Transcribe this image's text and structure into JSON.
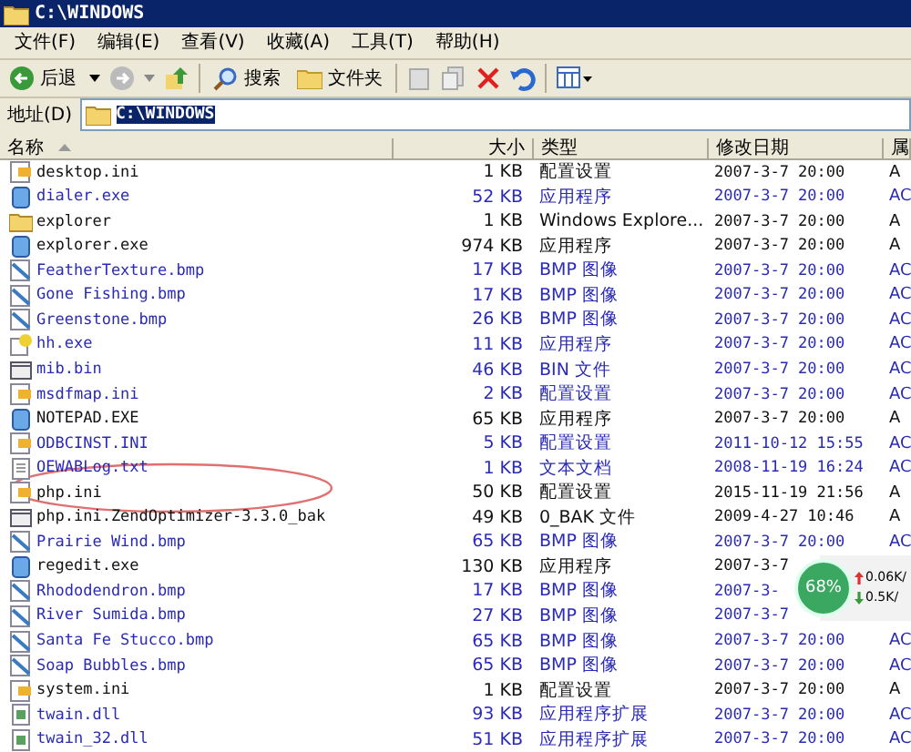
{
  "window": {
    "title": "C:\\WINDOWS"
  },
  "menu": [
    "文件(F)",
    "编辑(E)",
    "查看(V)",
    "收藏(A)",
    "工具(T)",
    "帮助(H)"
  ],
  "toolbar": {
    "back": "后退",
    "search": "搜索",
    "folders": "文件夹"
  },
  "address": {
    "label": "地址(D)",
    "value": "C:\\WINDOWS"
  },
  "columns": [
    "名称",
    "大小",
    "类型",
    "修改日期",
    "属"
  ],
  "rows": [
    {
      "kind": "ini",
      "name": "desktop.ini",
      "size": "1 KB",
      "type": "配置设置",
      "date": "2007-3-7 20:00",
      "attr": "A",
      "compressed": false
    },
    {
      "kind": "app",
      "name": "dialer.exe",
      "size": "52 KB",
      "type": "应用程序",
      "date": "2007-3-7 20:00",
      "attr": "AC",
      "compressed": true
    },
    {
      "kind": "folder",
      "name": "explorer",
      "size": "1 KB",
      "type": "Windows Explore...",
      "date": "2007-3-7 20:00",
      "attr": "A",
      "compressed": false
    },
    {
      "kind": "app",
      "name": "explorer.exe",
      "size": "974 KB",
      "type": "应用程序",
      "date": "2007-3-7 20:00",
      "attr": "A",
      "compressed": false
    },
    {
      "kind": "bmp",
      "name": "FeatherTexture.bmp",
      "size": "17 KB",
      "type": "BMP 图像",
      "date": "2007-3-7 20:00",
      "attr": "AC",
      "compressed": true
    },
    {
      "kind": "bmp",
      "name": "Gone Fishing.bmp",
      "size": "17 KB",
      "type": "BMP 图像",
      "date": "2007-3-7 20:00",
      "attr": "AC",
      "compressed": true
    },
    {
      "kind": "bmp",
      "name": "Greenstone.bmp",
      "size": "26 KB",
      "type": "BMP 图像",
      "date": "2007-3-7 20:00",
      "attr": "AC",
      "compressed": true
    },
    {
      "kind": "help",
      "name": "hh.exe",
      "size": "11 KB",
      "type": "应用程序",
      "date": "2007-3-7 20:00",
      "attr": "AC",
      "compressed": true
    },
    {
      "kind": "bin",
      "name": "mib.bin",
      "size": "46 KB",
      "type": "BIN 文件",
      "date": "2007-3-7 20:00",
      "attr": "AC",
      "compressed": true
    },
    {
      "kind": "ini",
      "name": "msdfmap.ini",
      "size": "2 KB",
      "type": "配置设置",
      "date": "2007-3-7 20:00",
      "attr": "AC",
      "compressed": true
    },
    {
      "kind": "app",
      "name": "NOTEPAD.EXE",
      "size": "65 KB",
      "type": "应用程序",
      "date": "2007-3-7 20:00",
      "attr": "A",
      "compressed": false
    },
    {
      "kind": "ini",
      "name": "ODBCINST.INI",
      "size": "5 KB",
      "type": "配置设置",
      "date": "2011-10-12 15:55",
      "attr": "AC",
      "compressed": true
    },
    {
      "kind": "txt",
      "name": "OEWABLog.txt",
      "size": "1 KB",
      "type": "文本文档",
      "date": "2008-11-19 16:24",
      "attr": "AC",
      "compressed": true
    },
    {
      "kind": "ini",
      "name": "php.ini",
      "size": "50 KB",
      "type": "配置设置",
      "date": "2015-11-19 21:56",
      "attr": "A",
      "compressed": false
    },
    {
      "kind": "bin",
      "name": "php.ini.ZendOptimizer-3.3.0_bak",
      "size": "49 KB",
      "type": "0_BAK 文件",
      "date": "2009-4-27 10:46",
      "attr": "A",
      "compressed": false
    },
    {
      "kind": "bmp",
      "name": "Prairie Wind.bmp",
      "size": "65 KB",
      "type": "BMP 图像",
      "date": "2007-3-7 20:00",
      "attr": "AC",
      "compressed": true
    },
    {
      "kind": "app",
      "name": "regedit.exe",
      "size": "130 KB",
      "type": "应用程序",
      "date": "2007-3-7",
      "compressed": false
    },
    {
      "kind": "bmp",
      "name": "Rhododendron.bmp",
      "size": "17 KB",
      "type": "BMP 图像",
      "date": "2007-3-",
      "compressed": true
    },
    {
      "kind": "bmp",
      "name": "River Sumida.bmp",
      "size": "27 KB",
      "type": "BMP 图像",
      "date": "2007-3-7",
      "compressed": true
    },
    {
      "kind": "bmp",
      "name": "Santa Fe Stucco.bmp",
      "size": "65 KB",
      "type": "BMP 图像",
      "date": "2007-3-7 20:00",
      "attr": "AC",
      "compressed": true
    },
    {
      "kind": "bmp",
      "name": "Soap Bubbles.bmp",
      "size": "65 KB",
      "type": "BMP 图像",
      "date": "2007-3-7 20:00",
      "attr": "AC",
      "compressed": true
    },
    {
      "kind": "ini",
      "name": "system.ini",
      "size": "1 KB",
      "type": "配置设置",
      "date": "2007-3-7 20:00",
      "attr": "A",
      "compressed": false
    },
    {
      "kind": "dll",
      "name": "twain.dll",
      "size": "93 KB",
      "type": "应用程序扩展",
      "date": "2007-3-7 20:00",
      "attr": "AC",
      "compressed": true
    },
    {
      "kind": "dll",
      "name": "twain_32.dll",
      "size": "51 KB",
      "type": "应用程序扩展",
      "date": "2007-3-7 20:00",
      "attr": "AC",
      "compressed": true
    }
  ],
  "monitor": {
    "percent": "68%",
    "up": "0.06K/",
    "down": "0.5K/"
  }
}
